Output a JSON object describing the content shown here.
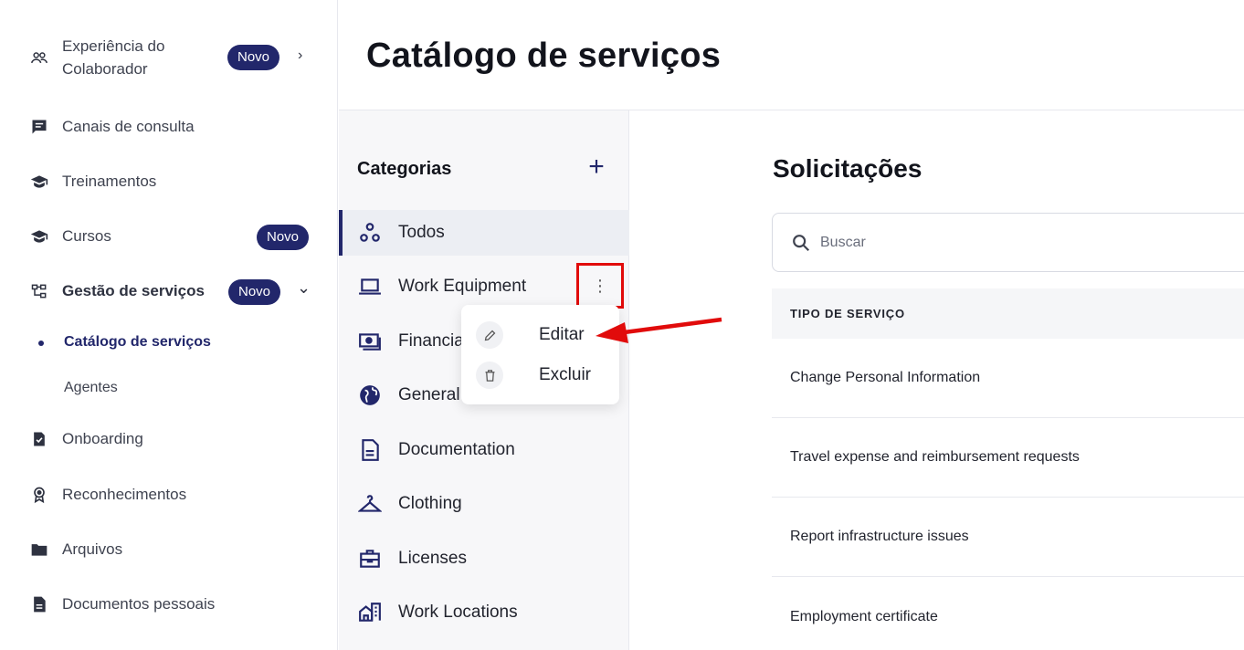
{
  "sidebar": {
    "items": [
      {
        "label_line1": "Experiência do",
        "label_line2": "Colaborador",
        "icon": "people-group-icon",
        "badge": "Novo",
        "chevron": "›"
      },
      {
        "label": "Canais de consulta",
        "icon": "chat-icon"
      },
      {
        "label": "Treinamentos",
        "icon": "graduation-cap-icon"
      },
      {
        "label": "Cursos",
        "icon": "graduation-cap-icon",
        "badge": "Novo"
      },
      {
        "label": "Gestão de serviços",
        "icon": "hierarchy-icon",
        "badge": "Novo",
        "chevron": "⌄"
      },
      {
        "label": "Onboarding",
        "icon": "clipboard-check-icon"
      },
      {
        "label": "Reconhecimentos",
        "icon": "award-icon"
      },
      {
        "label": "Arquivos",
        "icon": "folder-icon"
      },
      {
        "label": "Documentos pessoais",
        "icon": "document-icon"
      }
    ],
    "sub_items": [
      {
        "label": "Catálogo de serviços",
        "active": true
      },
      {
        "label": "Agentes",
        "active": false
      }
    ]
  },
  "header": {
    "title": "Catálogo de serviços"
  },
  "categories": {
    "title": "Categorias",
    "add_label": "+",
    "items": [
      {
        "label": "Todos",
        "icon": "circles-icon",
        "selected": true
      },
      {
        "label": "Work Equipment",
        "icon": "laptop-icon"
      },
      {
        "label": "Financia",
        "icon": "money-icon"
      },
      {
        "label": "General",
        "icon": "globe-icon"
      },
      {
        "label": "Documentation",
        "icon": "file-icon"
      },
      {
        "label": "Clothing",
        "icon": "hanger-icon"
      },
      {
        "label": "Licenses",
        "icon": "briefcase-icon"
      },
      {
        "label": "Work Locations",
        "icon": "building-icon"
      }
    ],
    "more_glyph": "⋮"
  },
  "context_menu": {
    "items": [
      {
        "label": "Editar",
        "icon": "pencil-icon"
      },
      {
        "label": "Excluir",
        "icon": "trash-icon"
      }
    ]
  },
  "requests": {
    "title": "Solicitações",
    "search_placeholder": "Buscar",
    "column_header": "TIPO DE SERVIÇO",
    "rows": [
      "Change Personal Information",
      "Travel expense and reimbursement requests",
      "Report infrastructure issues",
      "Employment certificate"
    ]
  },
  "colors": {
    "brand": "#22276b",
    "highlight": "#e10b0b"
  }
}
